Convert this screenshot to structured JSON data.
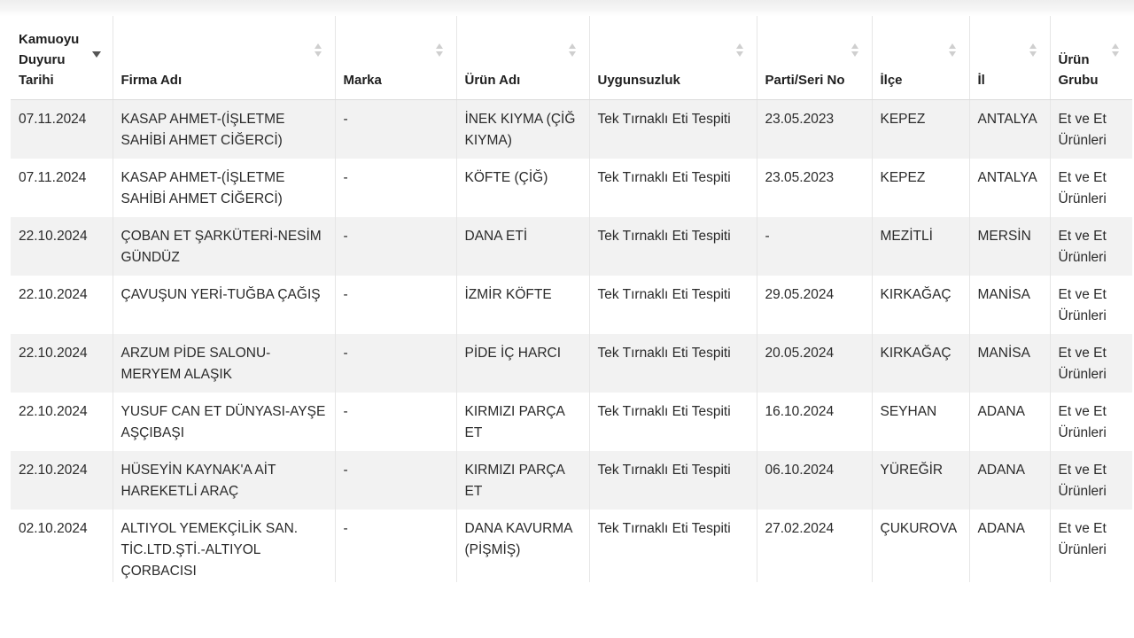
{
  "table": {
    "columns": [
      {
        "label": "Kamuoyu Duyuru Tarihi",
        "sorted": "desc"
      },
      {
        "label": "Firma Adı",
        "sorted": "none"
      },
      {
        "label": "Marka",
        "sorted": "none"
      },
      {
        "label": "Ürün Adı",
        "sorted": "none"
      },
      {
        "label": "Uygunsuzluk",
        "sorted": "none"
      },
      {
        "label": "Parti/Seri No",
        "sorted": "none"
      },
      {
        "label": "İlçe",
        "sorted": "none"
      },
      {
        "label": "İl",
        "sorted": "none"
      },
      {
        "label": "Ürün Grubu",
        "sorted": "none"
      }
    ],
    "rows": [
      [
        "07.11.2024",
        "KASAP AHMET-(İŞLETME SAHİBİ AHMET CİĞERCİ)",
        "-",
        "İNEK KIYMA (ÇİĞ KIYMA)",
        "Tek Tırnaklı Eti Tespiti",
        "23.05.2023",
        "KEPEZ",
        "ANTALYA",
        "Et ve Et Ürünleri"
      ],
      [
        "07.11.2024",
        "KASAP AHMET-(İŞLETME SAHİBİ AHMET CİĞERCİ)",
        "-",
        "KÖFTE (ÇİĞ)",
        "Tek Tırnaklı Eti Tespiti",
        "23.05.2023",
        "KEPEZ",
        "ANTALYA",
        "Et ve Et Ürünleri"
      ],
      [
        "22.10.2024",
        "ÇOBAN ET ŞARKÜTERİ-NESİM GÜNDÜZ",
        "-",
        "DANA ETİ",
        "Tek Tırnaklı Eti Tespiti",
        "-",
        "MEZİTLİ",
        "MERSİN",
        "Et ve Et Ürünleri"
      ],
      [
        "22.10.2024",
        "ÇAVUŞUN YERİ-TUĞBA ÇAĞIŞ",
        "-",
        "İZMİR KÖFTE",
        "Tek Tırnaklı Eti Tespiti",
        "29.05.2024",
        "KIRKAĞAÇ",
        "MANİSA",
        "Et ve Et Ürünleri"
      ],
      [
        "22.10.2024",
        "ARZUM PİDE SALONU-MERYEM ALAŞIK",
        "-",
        "PİDE İÇ HARCI",
        "Tek Tırnaklı Eti Tespiti",
        "20.05.2024",
        "KIRKAĞAÇ",
        "MANİSA",
        "Et ve Et Ürünleri"
      ],
      [
        "22.10.2024",
        "YUSUF CAN ET DÜNYASI-AYŞE AŞÇIBAŞI",
        "-",
        "KIRMIZI PARÇA ET",
        "Tek Tırnaklı Eti Tespiti",
        "16.10.2024",
        "SEYHAN",
        "ADANA",
        "Et ve Et Ürünleri"
      ],
      [
        "22.10.2024",
        "HÜSEYİN KAYNAK'A AİT HAREKETLİ ARAÇ",
        "-",
        "KIRMIZI PARÇA ET",
        "Tek Tırnaklı Eti Tespiti",
        "06.10.2024",
        "YÜREĞİR",
        "ADANA",
        "Et ve Et Ürünleri"
      ],
      [
        "02.10.2024",
        "ALTIYOL YEMEKÇİLİK SAN. TİC.LTD.ŞTİ.-ALTIYOL ÇORBACISI",
        "-",
        "DANA KAVURMA (PİŞMİŞ)",
        "Tek Tırnaklı Eti Tespiti",
        "27.02.2024",
        "ÇUKUROVA",
        "ADANA",
        "Et ve Et Ürünleri"
      ]
    ]
  }
}
